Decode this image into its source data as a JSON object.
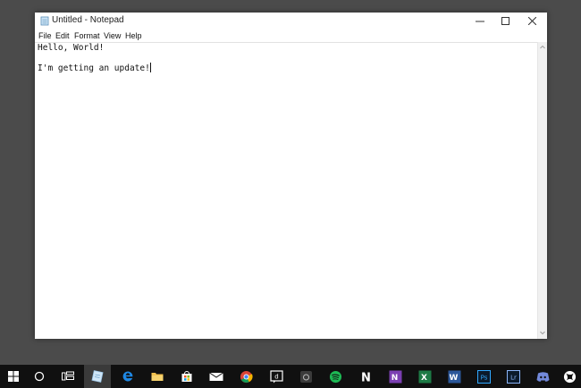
{
  "window": {
    "title": "Untitled - Notepad"
  },
  "menu": {
    "items": [
      {
        "label": "File"
      },
      {
        "label": "Edit"
      },
      {
        "label": "Format"
      },
      {
        "label": "View"
      },
      {
        "label": "Help"
      }
    ]
  },
  "editor": {
    "lines": [
      "Hello, World!",
      "",
      "I'm getting an update!"
    ]
  },
  "taskbar": {
    "icons": [
      "windows-start-icon",
      "cortana-search-icon",
      "task-view-icon",
      "notepad-app-icon",
      "edge-browser-icon",
      "file-explorer-icon",
      "store-icon",
      "mail-icon",
      "chrome-icon",
      "dictionary-app-icon",
      "camera-app-icon",
      "spotify-icon",
      "n-app-icon",
      "onenote-icon",
      "excel-icon",
      "word-icon",
      "photoshop-icon",
      "lightroom-icon",
      "discord-icon",
      "xbox-icon"
    ],
    "brand_text": {
      "onenote": "N",
      "excel": "X",
      "word": "W",
      "photoshop": "Ps",
      "lightroom": "Lr",
      "ntask": "N"
    },
    "colors": {
      "edge": "#1e88e5",
      "explorer": "#f2c14e",
      "spotify": "#1db954",
      "onenote": "#7b3fb2",
      "excel": "#1d7a45",
      "word": "#2b579a",
      "photoshop": "#31a8ff",
      "lightroom": "#8ab4f8",
      "discord": "#7289da"
    }
  }
}
